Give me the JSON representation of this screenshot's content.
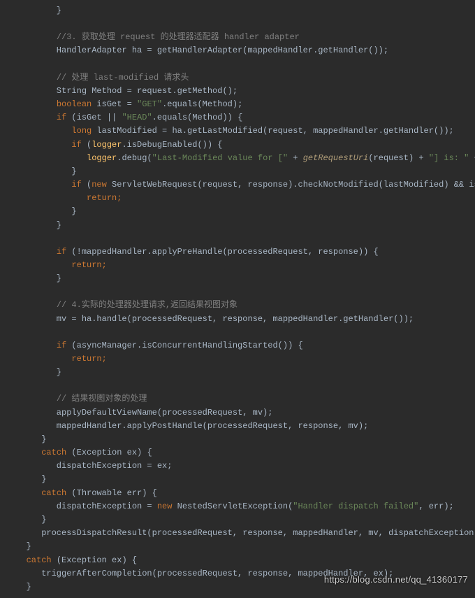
{
  "watermark": "https://blog.csdn.net/qq_41360177",
  "lines": [
    [
      [
        "plain",
        "         }"
      ]
    ],
    [
      [
        "plain",
        ""
      ]
    ],
    [
      [
        "plain",
        "         "
      ],
      [
        "comment",
        "//3. 获取处理 request 的处理器适配器 handler adapter"
      ]
    ],
    [
      [
        "plain",
        "         HandlerAdapter ha = getHandlerAdapter(mappedHandler.getHandler());"
      ]
    ],
    [
      [
        "plain",
        ""
      ]
    ],
    [
      [
        "plain",
        "         "
      ],
      [
        "comment",
        "// 处理 last-modified 请求头"
      ]
    ],
    [
      [
        "plain",
        "         String Method = request.getMethod();"
      ]
    ],
    [
      [
        "plain",
        "         "
      ],
      [
        "keyword",
        "boolean"
      ],
      [
        "plain",
        " isGet = "
      ],
      [
        "string",
        "\"GET\""
      ],
      [
        "plain",
        ".equals(Method);"
      ]
    ],
    [
      [
        "plain",
        "         "
      ],
      [
        "keyword",
        "if"
      ],
      [
        "plain",
        " (isGet || "
      ],
      [
        "string",
        "\"HEAD\""
      ],
      [
        "plain",
        ".equals(Method)) {"
      ]
    ],
    [
      [
        "plain",
        "            "
      ],
      [
        "keyword",
        "long"
      ],
      [
        "plain",
        " lastModified = ha.getLastModified(request, mappedHandler.getHandler());"
      ]
    ],
    [
      [
        "plain",
        "            "
      ],
      [
        "keyword",
        "if"
      ],
      [
        "plain",
        " ("
      ],
      [
        "method",
        "logger"
      ],
      [
        "plain",
        ".isDebugEnabled()) {"
      ]
    ],
    [
      [
        "plain",
        "               "
      ],
      [
        "method",
        "logger"
      ],
      [
        "plain",
        ".debug("
      ],
      [
        "string",
        "\"Last-Modified value for [\""
      ],
      [
        "plain",
        " + "
      ],
      [
        "fn",
        "getRequestUri"
      ],
      [
        "plain",
        "(request) + "
      ],
      [
        "string",
        "\"] is: \""
      ],
      [
        "plain",
        " + lastModified);"
      ]
    ],
    [
      [
        "plain",
        "            }"
      ]
    ],
    [
      [
        "plain",
        "            "
      ],
      [
        "keyword",
        "if"
      ],
      [
        "plain",
        " ("
      ],
      [
        "keyword",
        "new"
      ],
      [
        "plain",
        " ServletWebRequest(request, response).checkNotModified(lastModified) && isGet) {"
      ]
    ],
    [
      [
        "plain",
        "               "
      ],
      [
        "keyword",
        "return;"
      ]
    ],
    [
      [
        "plain",
        "            }"
      ]
    ],
    [
      [
        "plain",
        "         }"
      ]
    ],
    [
      [
        "plain",
        ""
      ]
    ],
    [
      [
        "plain",
        "         "
      ],
      [
        "keyword",
        "if"
      ],
      [
        "plain",
        " (!mappedHandler.applyPreHandle(processedRequest, response)) {"
      ]
    ],
    [
      [
        "plain",
        "            "
      ],
      [
        "keyword",
        "return;"
      ]
    ],
    [
      [
        "plain",
        "         }"
      ]
    ],
    [
      [
        "plain",
        ""
      ]
    ],
    [
      [
        "plain",
        "         "
      ],
      [
        "comment",
        "// 4.实际的处理器处理请求,返回结果视图对象"
      ]
    ],
    [
      [
        "plain",
        "         mv = ha.handle(processedRequest, response, mappedHandler.getHandler());"
      ]
    ],
    [
      [
        "plain",
        ""
      ]
    ],
    [
      [
        "plain",
        "         "
      ],
      [
        "keyword",
        "if"
      ],
      [
        "plain",
        " (asyncManager.isConcurrentHandlingStarted()) {"
      ]
    ],
    [
      [
        "plain",
        "            "
      ],
      [
        "keyword",
        "return;"
      ]
    ],
    [
      [
        "plain",
        "         }"
      ]
    ],
    [
      [
        "plain",
        ""
      ]
    ],
    [
      [
        "plain",
        "         "
      ],
      [
        "comment",
        "// 结果视图对象的处理"
      ]
    ],
    [
      [
        "plain",
        "         applyDefaultViewName(processedRequest, mv);"
      ]
    ],
    [
      [
        "plain",
        "         mappedHandler.applyPostHandle(processedRequest, response, mv);"
      ]
    ],
    [
      [
        "plain",
        "      }"
      ]
    ],
    [
      [
        "plain",
        "      "
      ],
      [
        "keyword",
        "catch"
      ],
      [
        "plain",
        " (Exception ex) {"
      ]
    ],
    [
      [
        "plain",
        "         dispatchException = ex;"
      ]
    ],
    [
      [
        "plain",
        "      }"
      ]
    ],
    [
      [
        "plain",
        "      "
      ],
      [
        "keyword",
        "catch"
      ],
      [
        "plain",
        " (Throwable err) {"
      ]
    ],
    [
      [
        "plain",
        "         dispatchException = "
      ],
      [
        "keyword",
        "new"
      ],
      [
        "plain",
        " NestedServletException("
      ],
      [
        "string",
        "\"Handler dispatch failed\""
      ],
      [
        "plain",
        ", err);"
      ]
    ],
    [
      [
        "plain",
        "      }"
      ]
    ],
    [
      [
        "plain",
        "      processDispatchResult(processedRequest, response, mappedHandler, mv, dispatchException);"
      ]
    ],
    [
      [
        "plain",
        "   }"
      ]
    ],
    [
      [
        "plain",
        "   "
      ],
      [
        "keyword",
        "catch"
      ],
      [
        "plain",
        " (Exception ex) {"
      ]
    ],
    [
      [
        "plain",
        "      triggerAfterCompletion(processedRequest, response, mappedHandler, ex);"
      ]
    ],
    [
      [
        "plain",
        "   }"
      ]
    ]
  ]
}
